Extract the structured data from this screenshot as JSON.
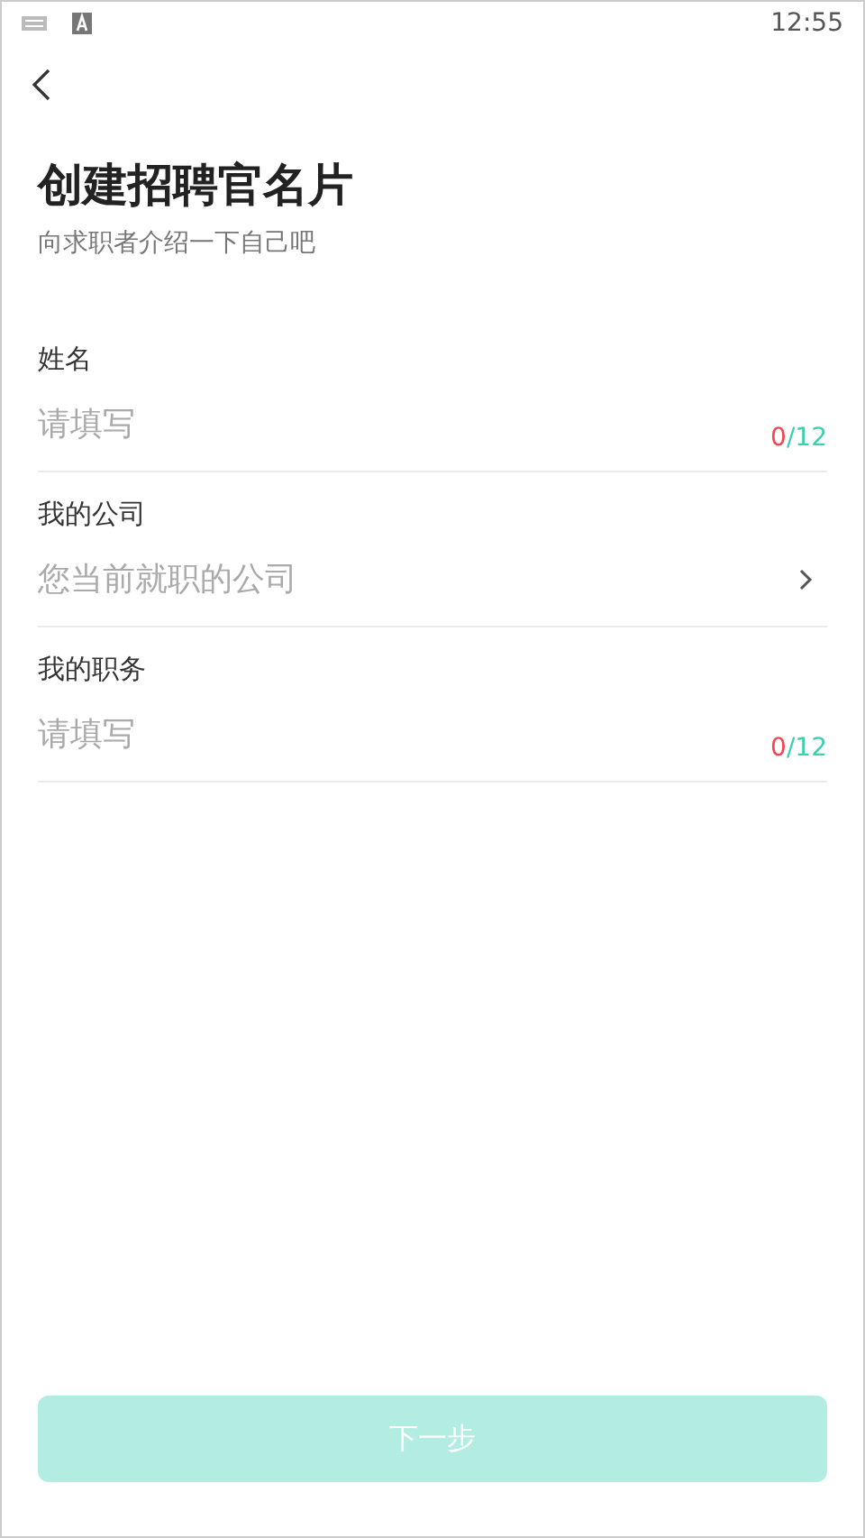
{
  "status_bar": {
    "time": "12:55"
  },
  "header": {
    "title": "创建招聘官名片",
    "subtitle": "向求职者介绍一下自己吧"
  },
  "fields": [
    {
      "kind": "text",
      "label": "姓名",
      "placeholder": "请填写",
      "count": "0",
      "limit": "/12"
    },
    {
      "kind": "select",
      "label": "我的公司",
      "placeholder": "您当前就职的公司"
    },
    {
      "kind": "text",
      "label": "我的职务",
      "placeholder": "请填写",
      "count": "0",
      "limit": "/12"
    }
  ],
  "next_button": {
    "label": "下一步",
    "disabled": true
  }
}
